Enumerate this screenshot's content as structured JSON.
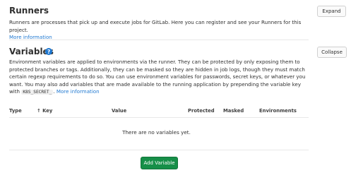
{
  "runners": {
    "title": "Runners",
    "description": "Runners are processes that pick up and execute jobs for GitLab. Here you can register and see your Runners for this project.",
    "more_info": "More information",
    "expand_label": "Expand"
  },
  "variables": {
    "title": "Variables",
    "help_glyph": "?",
    "description_before": "Environment variables are applied to environments via the runner. They can be protected by only exposing them to protected branches or tags. Additionally, they can be masked so they are hidden in job logs, though they must match certain regexp requirements to do so. You can use environment variables for passwords, secret keys, or whatever you want. You may also add variables that are made available to the running application by prepending the variable key with",
    "code_prefix": "K8S_SECRET_",
    "description_after": ".",
    "more_info": "More information",
    "collapse_label": "Collapse",
    "table": {
      "columns": [
        "Type",
        "Key",
        "Value",
        "Protected",
        "Masked",
        "Environments"
      ],
      "sort_glyph": "↑"
    },
    "empty_text": "There are no variables yet.",
    "add_label": "Add Variable"
  },
  "colors": {
    "link": "#1f78d1",
    "primary": "#168f48"
  }
}
